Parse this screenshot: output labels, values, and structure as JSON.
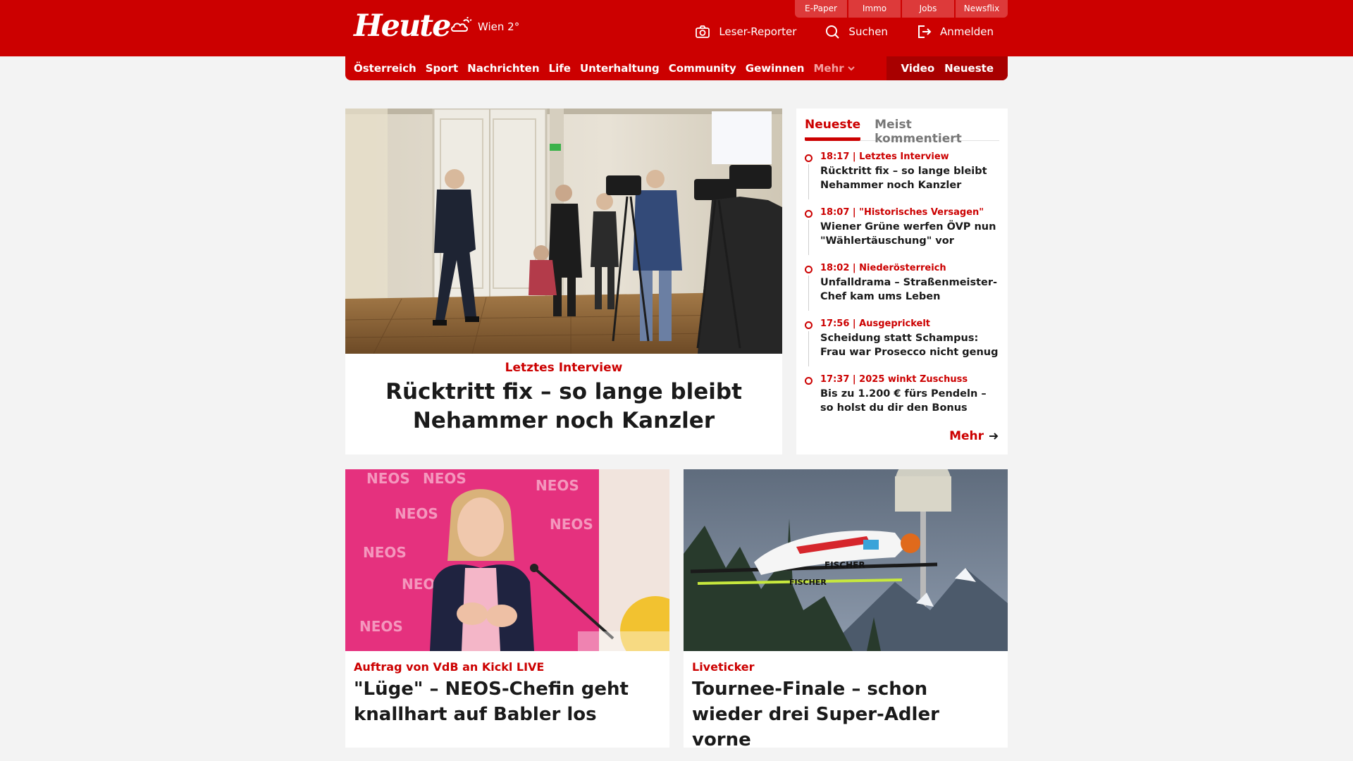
{
  "header": {
    "logo": "Heute",
    "weather": "Wien 2°",
    "util_tabs": [
      "E-Paper",
      "Immo",
      "Jobs",
      "Newsflix"
    ],
    "actions": {
      "reporter": "Leser-Reporter",
      "search": "Suchen",
      "login": "Anmelden"
    }
  },
  "nav": {
    "items": [
      "Österreich",
      "Sport",
      "Nachrichten",
      "Life",
      "Unterhaltung",
      "Community",
      "Gewinnen"
    ],
    "more": "Mehr",
    "video": "Video",
    "latest": "Neueste"
  },
  "hero": {
    "kicker": "Letztes Interview",
    "title": "Rücktritt fix – so lange bleibt Nehammer noch Kanzler"
  },
  "sidebar": {
    "tabs": [
      "Neueste",
      "Meist kommentiert"
    ],
    "items": [
      {
        "meta": "18:17 | Letztes Interview",
        "title": "Rücktritt fix – so lange bleibt Nehammer noch Kanzler"
      },
      {
        "meta": "18:07 | \"Historisches Versagen\"",
        "title": "Wiener Grüne werfen ÖVP nun \"Wählertäuschung\" vor"
      },
      {
        "meta": "18:02 | Niederösterreich",
        "title": "Unfalldrama – Straßenmeister-Chef kam ums Leben"
      },
      {
        "meta": "17:56 | Ausgeprickelt",
        "title": "Scheidung statt Schampus: Frau war Prosecco nicht genug"
      },
      {
        "meta": "17:37 | 2025 winkt Zuschuss",
        "title": "Bis zu 1.200 € fürs Pendeln – so holst du dir den Bonus"
      }
    ],
    "more": "Mehr"
  },
  "cards": [
    {
      "kicker": "Auftrag von VdB an Kickl LIVE",
      "title": "\"Lüge\" – NEOS-Chefin geht knallhart auf Babler los",
      "photo_text": "NEOS"
    },
    {
      "kicker": "Liveticker",
      "title": "Tournee-Finale  – schon wieder drei Super-Adler vorne",
      "photo_text": "FISCHER"
    }
  ],
  "colors": {
    "brand": "#cc0000",
    "brand_dark": "#a80000",
    "background": "#f3f3f3"
  }
}
